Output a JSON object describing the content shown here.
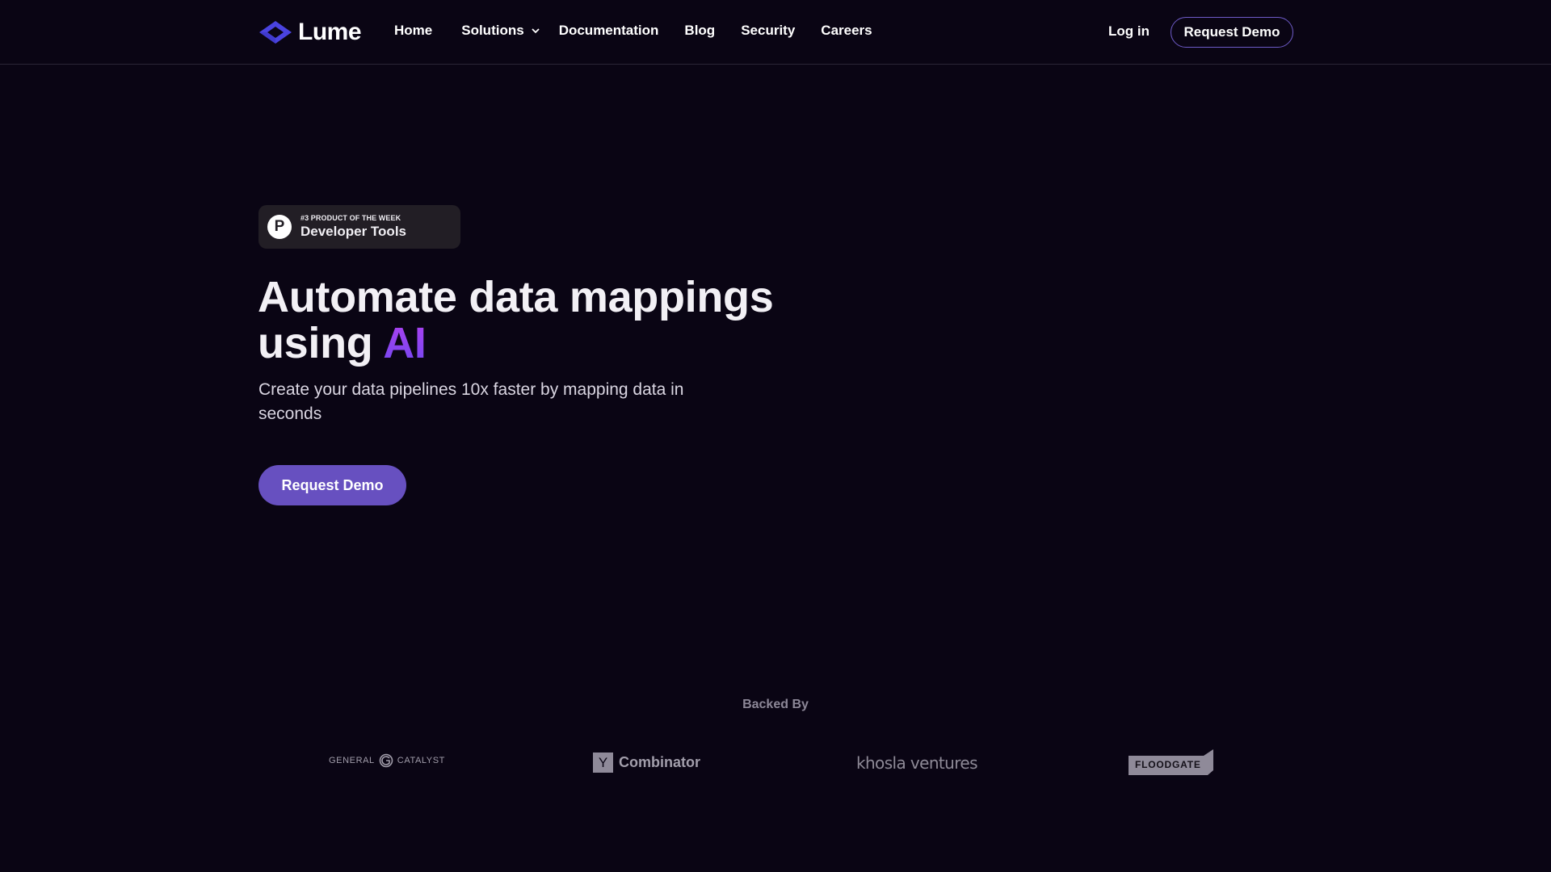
{
  "nav": {
    "brand": "Lume",
    "links": [
      {
        "label": "Home"
      },
      {
        "label": "Solutions",
        "has_dropdown": true
      },
      {
        "label": "Documentation"
      },
      {
        "label": "Blog"
      },
      {
        "label": "Security"
      },
      {
        "label": "Careers"
      }
    ],
    "login_label": "Log in",
    "demo_label": "Request Demo"
  },
  "badge": {
    "icon": "product-hunt-icon",
    "icon_letter": "P",
    "small_text": "#3 PRODUCT OF THE WEEK",
    "big_text": "Developer Tools"
  },
  "hero": {
    "title_main": "Automate data mappings using ",
    "title_highlight": "AI",
    "subtitle": "Create your data pipelines 10x faster by mapping data in seconds",
    "cta_label": "Request Demo"
  },
  "backed": {
    "label": "Backed By",
    "investors": [
      {
        "name_left": "GENERAL",
        "name_right": "CATALYST"
      },
      {
        "box_letter": "Y",
        "name": "Combinator"
      },
      {
        "name": "khosla ventures"
      },
      {
        "name": "FLOODGATE"
      }
    ]
  },
  "colors": {
    "background": "#0a0514",
    "accent": "#6750c0",
    "logo": "#4f46e5",
    "ai_gradient_top": "#b040f0",
    "ai_gradient_bottom": "#7048f0"
  }
}
